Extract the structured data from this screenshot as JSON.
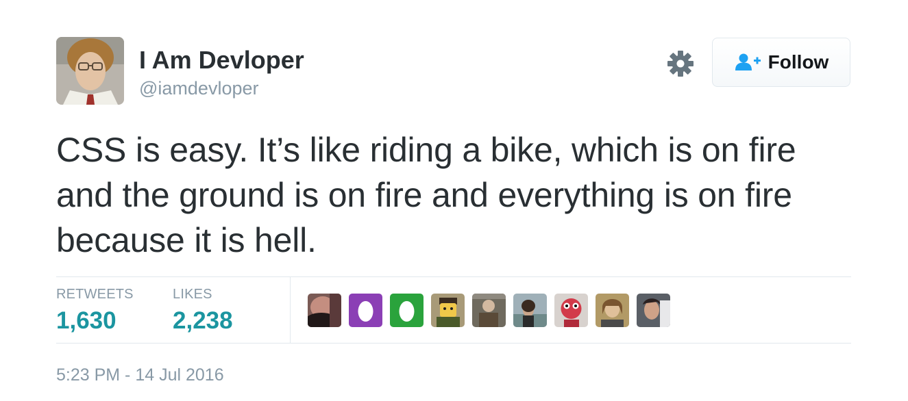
{
  "user": {
    "display_name": "I Am Devloper",
    "handle": "@iamdevloper",
    "avatar_icon": "profile-photo"
  },
  "actions": {
    "settings_icon": "gear-icon",
    "follow_label": "Follow",
    "follow_icon": "add-user-icon",
    "accent_color": "#1da1f2"
  },
  "tweet": {
    "lines": [
      "CSS is easy. It’s like riding a bike, which is on fire",
      "and the ground is on fire and everything is on fire",
      "because it is hell."
    ]
  },
  "stats": {
    "retweets_label": "RETWEETS",
    "retweets_count": "1,630",
    "likes_label": "LIKES",
    "likes_count": "2,238",
    "count_color": "#1b95a0"
  },
  "likers": [
    "liker-avatar-1",
    "liker-avatar-egg-purple",
    "liker-avatar-egg-green",
    "liker-avatar-lego",
    "liker-avatar-4",
    "liker-avatar-5",
    "liker-avatar-6",
    "liker-avatar-7",
    "liker-avatar-8"
  ],
  "timestamp": "5:23 PM - 14 Jul 2016"
}
